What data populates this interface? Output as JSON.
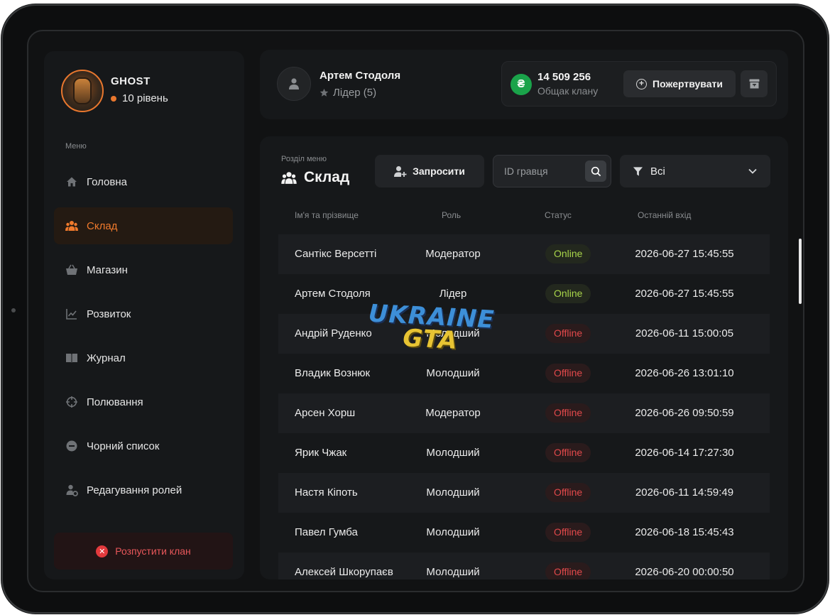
{
  "clan": {
    "name": "GHOST",
    "level": "10 рівень"
  },
  "menu": {
    "caption": "Меню",
    "items": [
      {
        "label": "Головна",
        "icon": "home-icon"
      },
      {
        "label": "Склад",
        "icon": "users-icon"
      },
      {
        "label": "Магазин",
        "icon": "basket-icon"
      },
      {
        "label": "Розвиток",
        "icon": "chart-icon"
      },
      {
        "label": "Журнал",
        "icon": "book-icon"
      },
      {
        "label": "Полювання",
        "icon": "crosshair-icon"
      },
      {
        "label": "Чорний список",
        "icon": "minus-circle-icon"
      },
      {
        "label": "Редагування ролей",
        "icon": "user-gear-icon"
      }
    ],
    "active_index": 1,
    "disband_label": "Розпустити клан"
  },
  "user": {
    "name": "Артем Стодоля",
    "role": "Лідер (5)"
  },
  "balance": {
    "amount": "14 509 256",
    "label": "Общак клану",
    "currency_symbol": "₴",
    "donate_label": "Пожертвувати"
  },
  "section": {
    "caption": "Розділ меню",
    "title": "Склад"
  },
  "toolbar": {
    "invite_label": "Запросити",
    "search_placeholder": "ID гравця",
    "filter_value": "Всі"
  },
  "table": {
    "headers": [
      "Ім'я та прізвище",
      "Роль",
      "Статус",
      "Останній вхід"
    ],
    "rows": [
      {
        "name": "Сантікс Версетті",
        "role": "Модератор",
        "status": "Online",
        "last": "2026-06-27 15:45:55"
      },
      {
        "name": "Артем Стодоля",
        "role": "Лідер",
        "status": "Online",
        "last": "2026-06-27 15:45:55"
      },
      {
        "name": "Андрій Руденко",
        "role": "Молодший",
        "status": "Offline",
        "last": "2026-06-11 15:00:05"
      },
      {
        "name": "Владик Вознюк",
        "role": "Молодший",
        "status": "Offline",
        "last": "2026-06-26 13:01:10"
      },
      {
        "name": "Арсен Хорш",
        "role": "Модератор",
        "status": "Offline",
        "last": "2026-06-26 09:50:59"
      },
      {
        "name": "Ярик Чжак",
        "role": "Молодший",
        "status": "Offline",
        "last": "2026-06-14 17:27:30"
      },
      {
        "name": "Настя Кіпоть",
        "role": "Молодший",
        "status": "Offline",
        "last": "2026-06-11 14:59:49"
      },
      {
        "name": "Павел Гумба",
        "role": "Молодший",
        "status": "Offline",
        "last": "2026-06-18 15:45:43"
      },
      {
        "name": "Алексей Шкорупаєв",
        "role": "Молодший",
        "status": "Offline",
        "last": "2026-06-20 00:00:50"
      }
    ]
  },
  "watermark": {
    "line1": "UKRAINE",
    "line2": "GTA"
  },
  "colors": {
    "accent": "#f07a2c",
    "online": "#a9d54a",
    "offline": "#e2494b",
    "money": "#1aa34a",
    "danger": "#e23a3d"
  }
}
